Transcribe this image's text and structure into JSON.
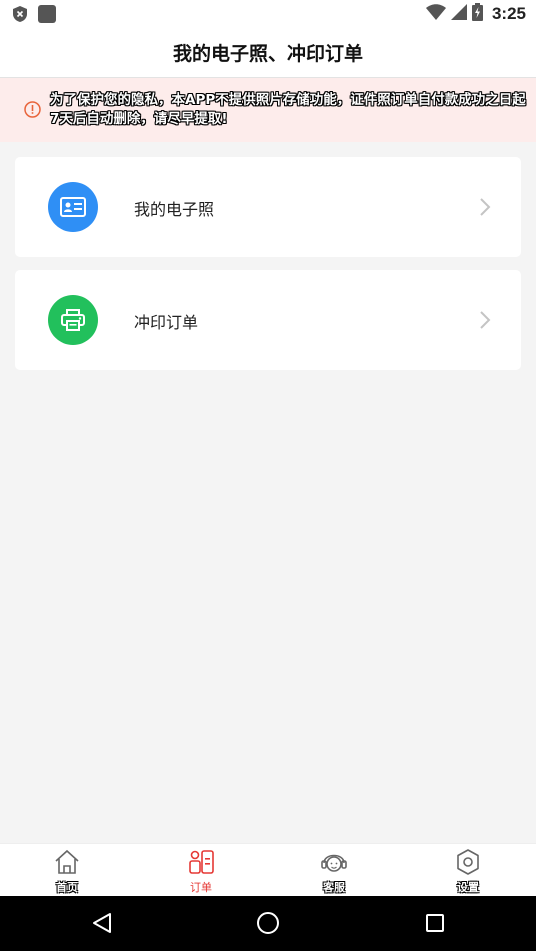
{
  "status_bar": {
    "time": "3:25",
    "left_icons": [
      "shield-icon",
      "app-square-icon"
    ],
    "right_icons": [
      "wifi-icon",
      "signal-icon",
      "battery-charging-icon"
    ]
  },
  "header": {
    "title": "我的电子照、冲印订单"
  },
  "notice": {
    "icon": "info-circle-icon",
    "text": "为了保护您的隐私，本APP不提供照片存储功能，证件照订单自付款成功之日起7天后自动删除，请尽早提取!"
  },
  "menu": {
    "items": [
      {
        "label": "我的电子照",
        "icon": "id-card-icon",
        "icon_color": "#2f8ff5"
      },
      {
        "label": "冲印订单",
        "icon": "printer-icon",
        "icon_color": "#22c05c"
      }
    ]
  },
  "tab_bar": {
    "items": [
      {
        "label": "首页",
        "icon": "home-icon",
        "active": false
      },
      {
        "label": "订单",
        "icon": "order-icon",
        "active": true
      },
      {
        "label": "客服",
        "icon": "customer-service-icon",
        "active": false
      },
      {
        "label": "设置",
        "icon": "settings-icon",
        "active": false
      }
    ],
    "active_color": "#e53935"
  },
  "nav_bar": {
    "buttons": [
      "back-icon",
      "home-circle-icon",
      "recents-icon"
    ]
  }
}
